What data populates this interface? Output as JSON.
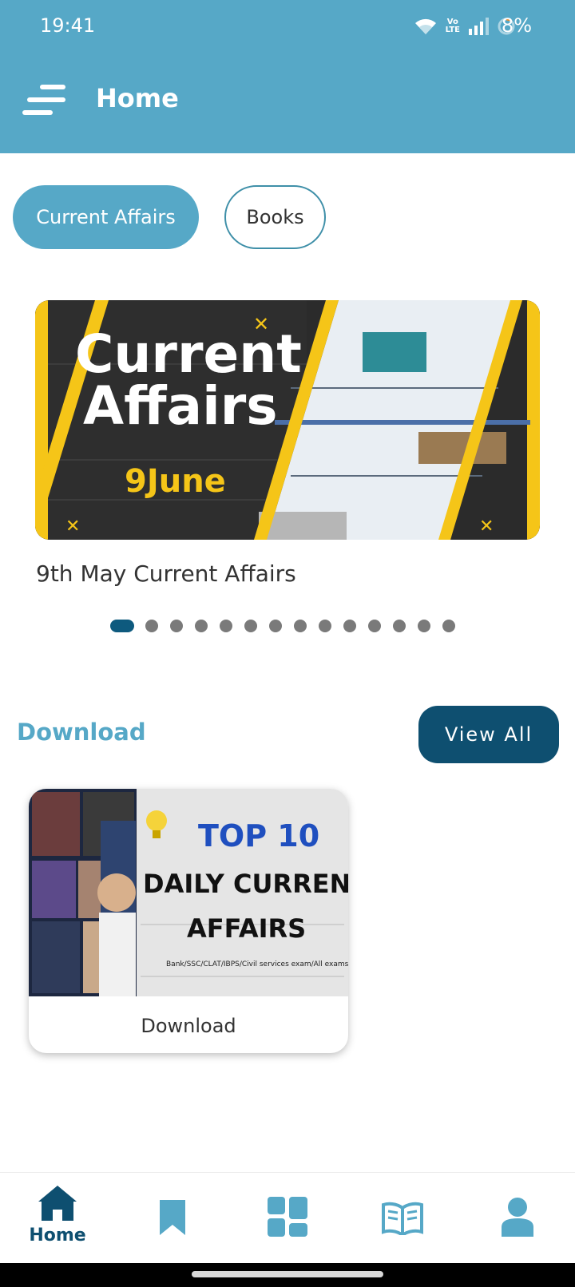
{
  "status_bar": {
    "time": "19:41",
    "volte_top": "Vo",
    "volte_bottom": "LTE",
    "battery": "8%"
  },
  "header": {
    "title": "Home",
    "menu_icon": "menu-icon"
  },
  "tabs": [
    {
      "label": "Current Affairs",
      "active": true
    },
    {
      "label": "Books",
      "active": false
    }
  ],
  "carousel": {
    "banner_line1": "Current",
    "banner_line2": "Affairs",
    "banner_date": "9June",
    "caption": "9th May Current Affairs",
    "page_count": 14,
    "active_index": 0
  },
  "download_section": {
    "title": "Download",
    "view_all_label": "View All",
    "card": {
      "image_line1": "TOP 10",
      "image_line2": "DAILY CURRENT",
      "image_line3": "AFFAIRS",
      "image_subtitle": "Bank/SSC/CLAT/IBPS/Civil services exam/All exams",
      "label": "Download"
    }
  },
  "bottom_nav": [
    {
      "label": "Home",
      "icon": "home-icon",
      "active": true
    },
    {
      "label": "",
      "icon": "bookmark-icon",
      "active": false
    },
    {
      "label": "",
      "icon": "grid-icon",
      "active": false
    },
    {
      "label": "",
      "icon": "book-icon",
      "active": false
    },
    {
      "label": "",
      "icon": "profile-icon",
      "active": false
    }
  ],
  "colors": {
    "primary": "#56A8C7",
    "dark": "#0E4F70",
    "accent_yellow": "#F5C518"
  }
}
